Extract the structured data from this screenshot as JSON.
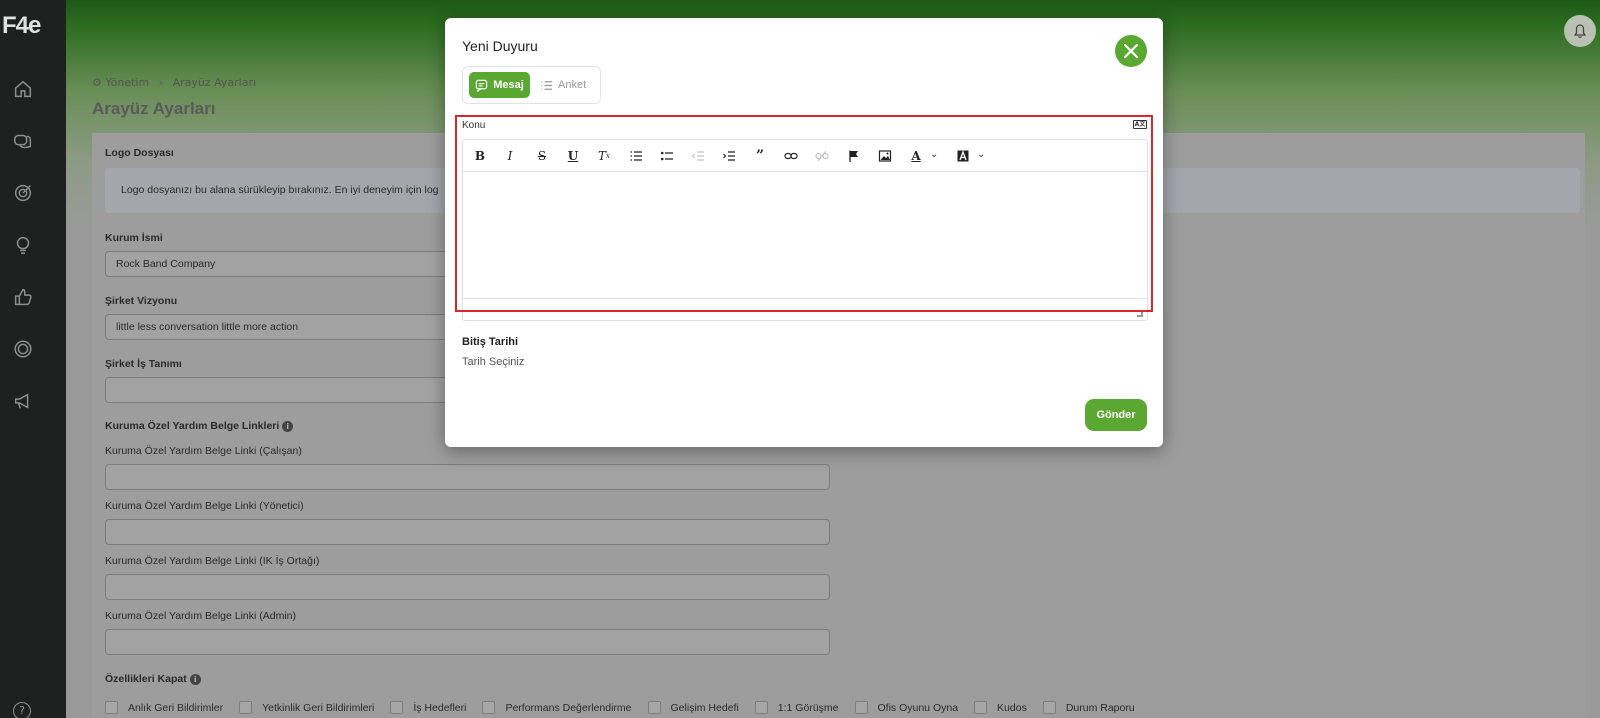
{
  "sidebar": {
    "logo": "F4e",
    "items": [
      "home-icon",
      "chat-icon",
      "target-icon",
      "lightbulb-icon",
      "thumbs-up-icon",
      "badge-icon",
      "megaphone-icon"
    ],
    "help": "?"
  },
  "header": {
    "breadcrumb": {
      "root": "Yönetim",
      "separator": "›",
      "current": "Arayüz Ayarları"
    },
    "title": "Arayüz Ayarları"
  },
  "form": {
    "logo_label": "Logo Dosyası",
    "logo_info": "Logo dosyanızı bu alana sürükleyip bırakınız. En iyi deneyim için log",
    "company_name_label": "Kurum İsmi",
    "company_name_value": "Rock Band Company",
    "vision_label": "Şirket Vizyonu",
    "vision_value": "little less conversation little more action",
    "job_desc_label": "Şirket İş Tanımı",
    "help_links_label": "Kuruma Özel Yardım Belge Linkleri",
    "help_link_employee_label": "Kuruma Özel Yardım Belge Linki (Çalışan)",
    "help_link_manager_label": "Kuruma Özel Yardım Belge Linki (Yönetici)",
    "help_link_hr_label": "Kuruma Özel Yardım Belge Linki (IK İş Ortağı)",
    "help_link_admin_label": "Kuruma Özel Yardım Belge Linki (Admin)",
    "disable_features_label": "Özellikleri Kapat",
    "features": [
      "Anlık Geri Bildirimler",
      "Yetkinlik Geri Bildirimleri",
      "İş Hedefleri",
      "Performans Değerlendirme",
      "Gelişim Hedefi",
      "1:1 Görüşme",
      "Ofis Oyunu Oyna",
      "Kudos",
      "Durum Raporu"
    ]
  },
  "modal": {
    "title": "Yeni Duyuru",
    "tabs": {
      "message": "Mesaj",
      "survey": "Anket"
    },
    "subject_label": "Konu",
    "end_date_label": "Bitiş Tarihi",
    "date_placeholder": "Tarih Seçiniz",
    "send_label": "Gönder",
    "colors": {
      "accent": "#5aa832",
      "highlight": "#d8262a"
    }
  }
}
